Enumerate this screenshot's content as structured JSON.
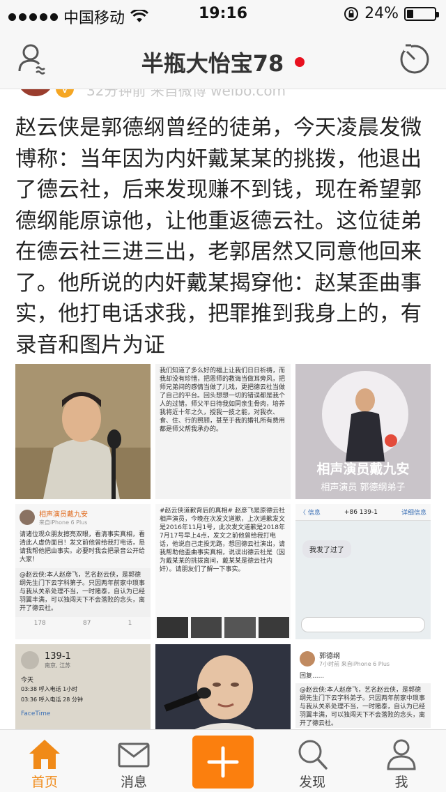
{
  "status_bar": {
    "carrier": "中国移动",
    "time": "19:16",
    "battery": "24%",
    "battery_level": 0.24
  },
  "nav": {
    "title": "半瓶大怡宝78",
    "left_icon": "profile-icon",
    "right_icon": "radar-icon"
  },
  "post": {
    "meta": "32分钟前  来自微博 weibo.com",
    "text": "赵云侠是郭德纲曾经的徒弟，今天凌晨发微博称：当年因为内奸戴某某的挑拨，他退出了德云社，后来发现赚不到钱，现在希望郭德纲能原谅他，让他重返德云社。这位徒弟在德云社三进三出，老郭居然又同意他回来了。他所说的内奸戴某揭穿他：赵某歪曲事实，他打电话求我，把罪推到我身上的，有录音和图片为证"
  },
  "images": {
    "c2_text": "我们知道了多么好的福上让我们日日祈祷，而我却没有珍惜，把恩师的教诲当做耳旁风，把师兄弟间的感情当做了儿戏，更把德云社当做了自己的平台。回头想想一切的错误都是我个人的过错。师父平日待我如同亲生骨肉，培养我将近十年之久，授我一技之能，对我衣、食、住、行的照顾，甚至于我的婚礼所有费用都是师父帮我承办的。",
    "c3_caption": "相声演员戴九安",
    "c3_sub": "相声演员 郭德纲弟子",
    "c4_name": "相声演员戴九安",
    "c4_source": "来自iPhone 6 Plus",
    "c4_text": "请诸位观众朋友擦亮双眼，看清事实真相，看清此人虚伪面目！发文前他曾给我打电话，恳请我帮他把由事实。必要时我会把录音公开给大家！",
    "c4_quote": "@赵云侠:本人赵彦飞，艺名赵云侠，是郭德纲先生门下云字科第子。只因两年前家中琐事与我从关系处理不当，一时赌泰，自认为已经羽翼丰满，可以独闯天下不会落败的念头，离开了德云社。",
    "c4_counts": [
      "178",
      "87",
      "1"
    ],
    "c5_text": "#赵云侠道歉背后的真相#  赵彦飞是原德云社相声演员，今晚在次发文道歉，上次道歉发文是2016年11月1号，此次发文道歉是2018年7月17号早上4点，发文之前他曾给我打电话，他说自己走投无路，想回德云社演出，请我帮助他歪曲事实真相，说误出德云社是（因为戴某某的挑拨离间，戴某某是德云社内奸）。请朋友们了解一下事实。",
    "c6_back": "〈 信息",
    "c6_number": "+86 139-1",
    "c6_detail": "详细信息",
    "c6_bubble": "我发了过了",
    "c7_number": "139-1",
    "c7_location": "南京, 江苏",
    "c7_today": "今天",
    "c7_calls": [
      "03:38  呼入电话  1小时",
      "03:36  呼入电话  28 分钟"
    ],
    "c7_facetime": "FaceTime",
    "c9_name": "郭德纲",
    "c9_source": "7小时前  来自iPhone 6 Plus",
    "c9_reply": "回复......",
    "c9_quote": "@赵云侠:本人赵彦飞，艺名赵云侠，是郭德纲先生门下云字科弟子。只因两年前家中琐事与我从关系处理不当，一时赌泰，自认为已经羽翼丰满，可以独闯天下不会落败的念头，离开了德云社。"
  },
  "tabs": [
    {
      "label": "首页",
      "icon": "home-icon",
      "active": true
    },
    {
      "label": "消息",
      "icon": "mail-icon"
    },
    {
      "label": "",
      "icon": "plus-icon"
    },
    {
      "label": "发现",
      "icon": "search-icon"
    },
    {
      "label": "我",
      "icon": "person-icon"
    }
  ],
  "colors": {
    "accent": "#fb7f0e",
    "active_tab": "#f08a18",
    "notify_dot": "#e8111f"
  }
}
